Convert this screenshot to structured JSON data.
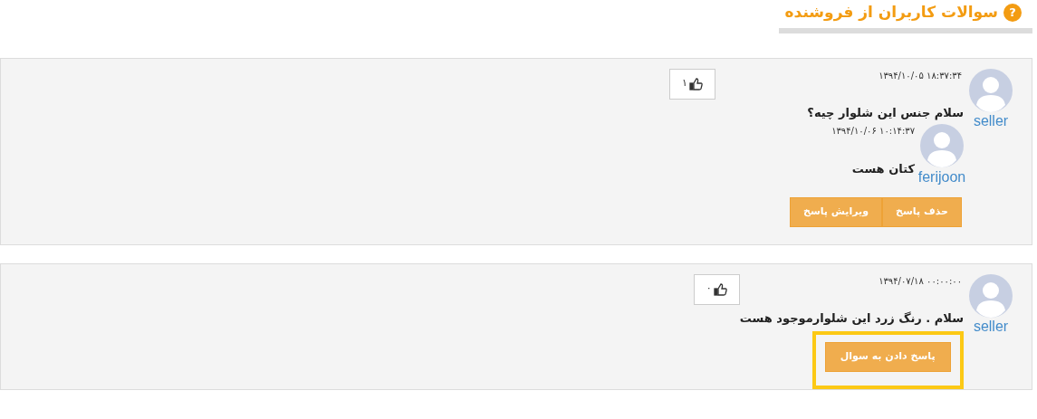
{
  "header": {
    "title": "سوالات کاربران از فروشنده",
    "icon": "?"
  },
  "questions": [
    {
      "author": "seller",
      "date": "۱۸:۳۷:۳۴ ۱۳۹۴/۱۰/۰۵",
      "text": "سلام جنس این شلوار چیه؟",
      "likes": "۱",
      "replies": [
        {
          "author": "ferijoon",
          "date": "۱۰:۱۴:۳۷ ۱۳۹۴/۱۰/۰۶",
          "text": "کتان هست"
        }
      ],
      "actions": [
        {
          "label": "حذف پاسخ",
          "highlighted": false
        },
        {
          "label": "ویرایش پاسخ",
          "highlighted": false
        }
      ]
    },
    {
      "author": "seller",
      "date": "۰۰:۰۰:۰۰ ۱۳۹۴/۰۷/۱۸",
      "text": "سلام . رنگ زرد این شلوارموجود هست",
      "likes": "۰",
      "actions": [
        {
          "label": "پاسخ دادن به سوال",
          "highlighted": true
        }
      ]
    }
  ]
}
